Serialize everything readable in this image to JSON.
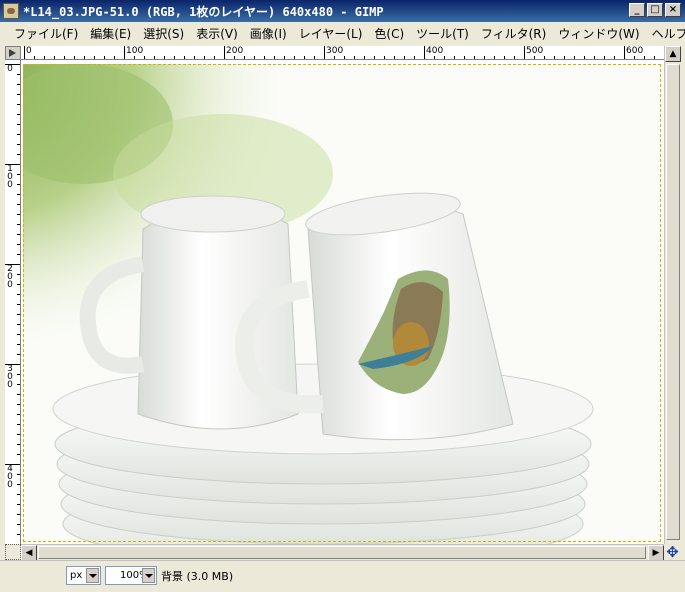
{
  "window": {
    "title": "*L14_03.JPG-51.0 (RGB, 1枚のレイヤー) 640x480 - GIMP",
    "minimize_label": "_",
    "maximize_label": "□",
    "close_label": "×"
  },
  "menu": {
    "items": [
      "ファイル(F)",
      "編集(E)",
      "選択(S)",
      "表示(V)",
      "画像(I)",
      "レイヤー(L)",
      "色(C)",
      "ツール(T)",
      "フィルタ(R)",
      "ウィンドウ(W)",
      "ヘルプ(H)"
    ]
  },
  "rulers": {
    "horizontal": [
      "0",
      "100",
      "200",
      "300",
      "400",
      "500",
      "600"
    ],
    "vertical": [
      "0",
      "100",
      "200",
      "300",
      "400"
    ]
  },
  "statusbar": {
    "unit": "px",
    "zoom": "100%",
    "layer_info": "背景 (3.0 MB)"
  },
  "icons": {
    "app": "gimp-image-icon",
    "ruler_corner": "menu-arrow-icon",
    "quick_mask": "quick-mask-icon",
    "navigate": "navigate-icon"
  },
  "colors": {
    "titlebar": "#0a246a",
    "background_green": "#c9d9a8",
    "selection_bird_bg": "#9cb07a"
  }
}
